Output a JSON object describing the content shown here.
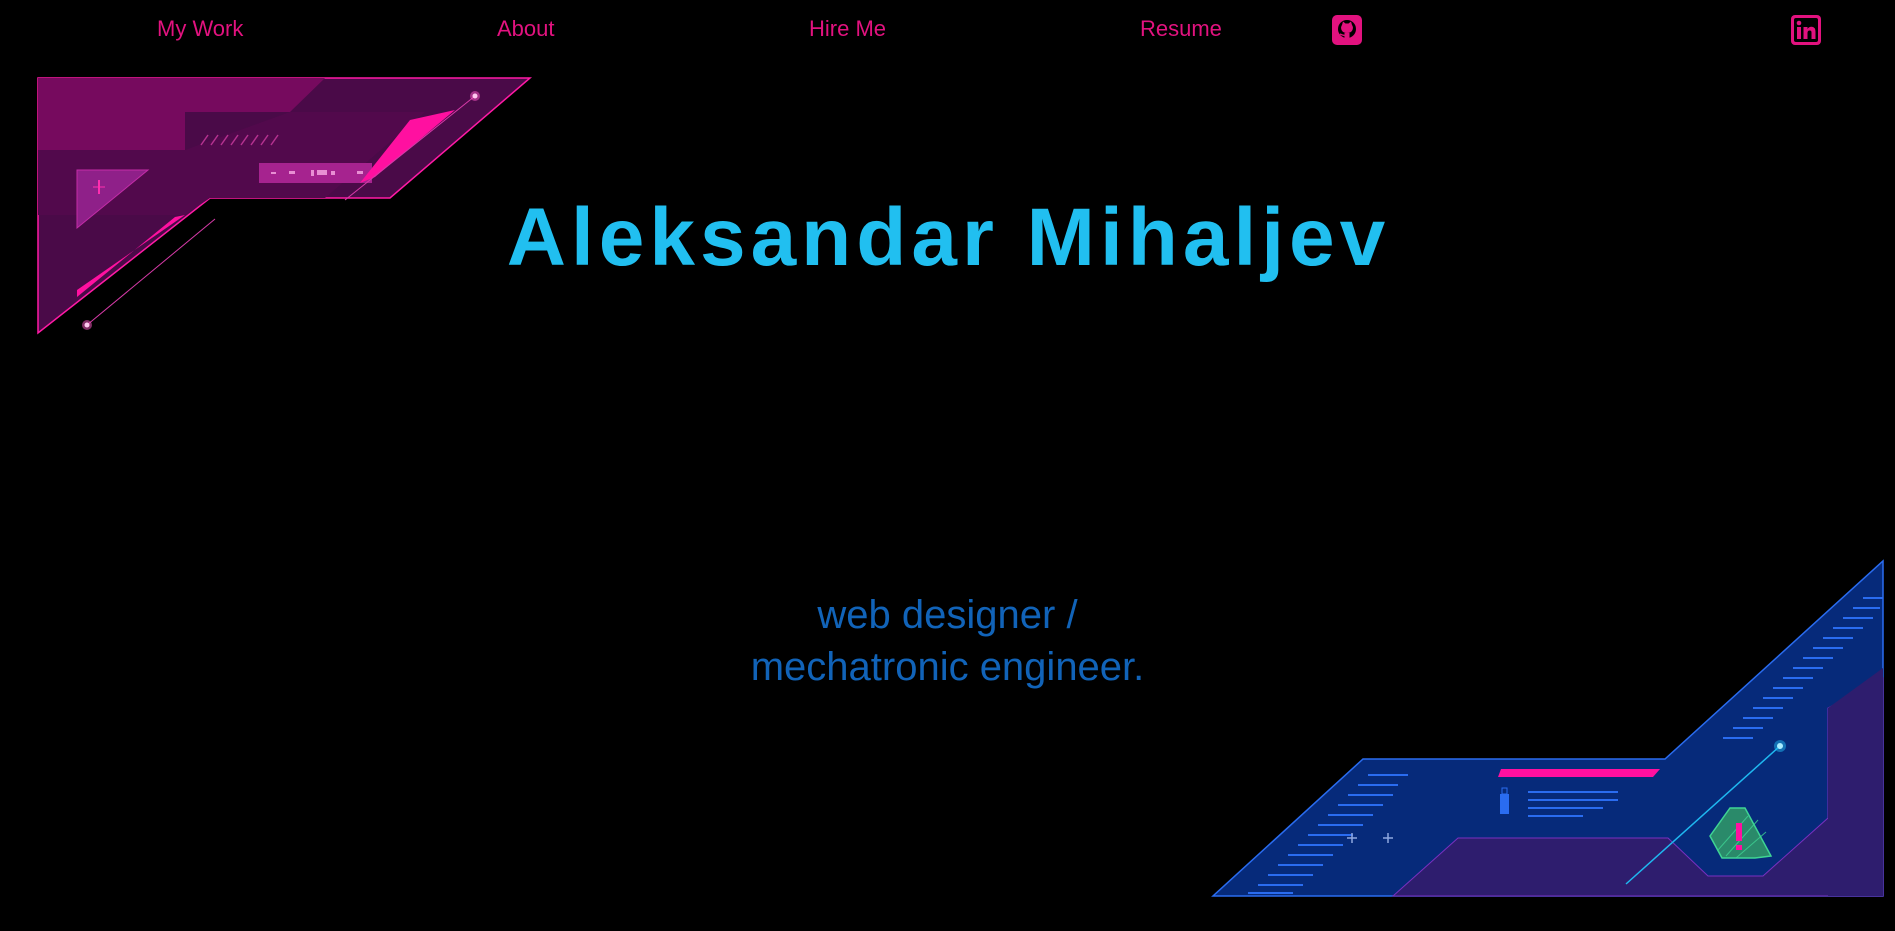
{
  "nav": {
    "links": [
      {
        "label": "My Work"
      },
      {
        "label": "About"
      },
      {
        "label": "Hire Me"
      },
      {
        "label": "Resume"
      }
    ],
    "icons": [
      "github-icon",
      "linkedin-icon"
    ]
  },
  "hero": {
    "name": "Aleksandar Mihaljev",
    "subtitle_line1": "web designer /",
    "subtitle_line2": "mechatronic engineer."
  },
  "colors": {
    "nav": "#e2127f",
    "title": "#21bff0",
    "subtitle": "#1163b8",
    "magenta_panel": "#4a0a48",
    "blue_panel": "#062a7a",
    "background": "#000000"
  }
}
